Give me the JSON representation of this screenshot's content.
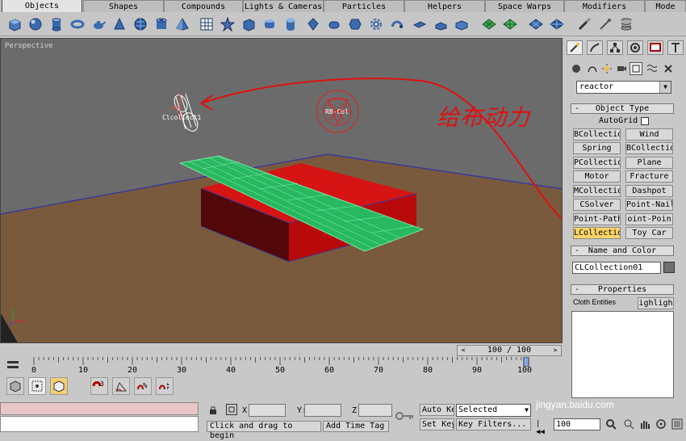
{
  "command_tabs": [
    {
      "label": "Objects",
      "active": true
    },
    {
      "label": "Shapes",
      "active": false
    },
    {
      "label": "Compounds",
      "active": false
    },
    {
      "label": "Lights & Cameras",
      "active": false
    },
    {
      "label": "Particles",
      "active": false
    },
    {
      "label": "Helpers",
      "active": false
    },
    {
      "label": "Space Warps",
      "active": false
    },
    {
      "label": "Modifiers",
      "active": false
    },
    {
      "label": "Mode",
      "active": false
    }
  ],
  "viewport": {
    "label": "Perspective",
    "objects": {
      "cloth_collection": "Clcollect1",
      "rigid_body_collection": "RB-Col"
    }
  },
  "annotation": {
    "handwritten_text": "给布动力",
    "color": "#e01010"
  },
  "command_panel": {
    "dropdown_value": "reactor",
    "object_type": {
      "title": "Object Type",
      "autogrid_label": "AutoGrid",
      "buttons": [
        "BCollectio",
        "Wind",
        "Spring",
        "BCollectio",
        "PCollectio",
        "Plane",
        "Motor",
        "Fracture",
        "MCollectio",
        "Dashpot",
        "CSolver",
        "Point-Nail",
        "Point-Path",
        "oint-Poin",
        "LCollectio",
        "Toy Car"
      ],
      "selected_index": 14
    },
    "name_and_color": {
      "title": "Name and Color",
      "name_value": "CLCollection01",
      "color": "#6f6f6f"
    },
    "properties": {
      "title": "Properties",
      "cloth_entities_label": "Cloth Entities",
      "highlight_button": "ighligh"
    }
  },
  "time_slider": {
    "current": 100,
    "total": 100,
    "label": "100 / 100"
  },
  "track_ruler": {
    "ticks": [
      "0",
      "10",
      "20",
      "30",
      "40",
      "50",
      "60",
      "70",
      "80",
      "90",
      "100"
    ]
  },
  "status_bar": {
    "coord_x_label": "X:",
    "coord_y_label": "Y:",
    "coord_z_label": "Z:",
    "prompt": "Click and drag to begin",
    "add_time_tag": "Add Time Tag",
    "auto_key": "Auto Key",
    "set_key": "Set Key",
    "selected": "Selected",
    "key_filters": "Key Filters...",
    "frame_value": "100"
  },
  "watermark": "jingyan.baidu.com"
}
